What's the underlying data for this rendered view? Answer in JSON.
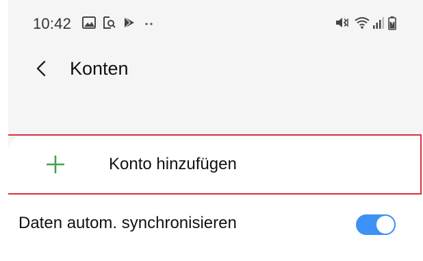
{
  "status_bar": {
    "time": "10:42",
    "icons_left": [
      "gallery-icon",
      "screenshot-icon",
      "play-store-icon",
      "more-dots-icon"
    ],
    "icons_right": [
      "mute-vibrate-icon",
      "wifi-icon",
      "signal-icon",
      "battery-icon"
    ]
  },
  "header": {
    "back_icon": "chevron-left-icon",
    "title": "Konten"
  },
  "list": {
    "add_account": {
      "icon": "plus-icon",
      "label": "Konto hinzufügen"
    },
    "auto_sync": {
      "label": "Daten autom. synchronisieren",
      "enabled": true
    }
  },
  "colors": {
    "accent_green": "#3fa34d",
    "toggle_blue": "#3e91f5",
    "highlight_red": "#d9303a",
    "background": "#f5f5f5"
  }
}
